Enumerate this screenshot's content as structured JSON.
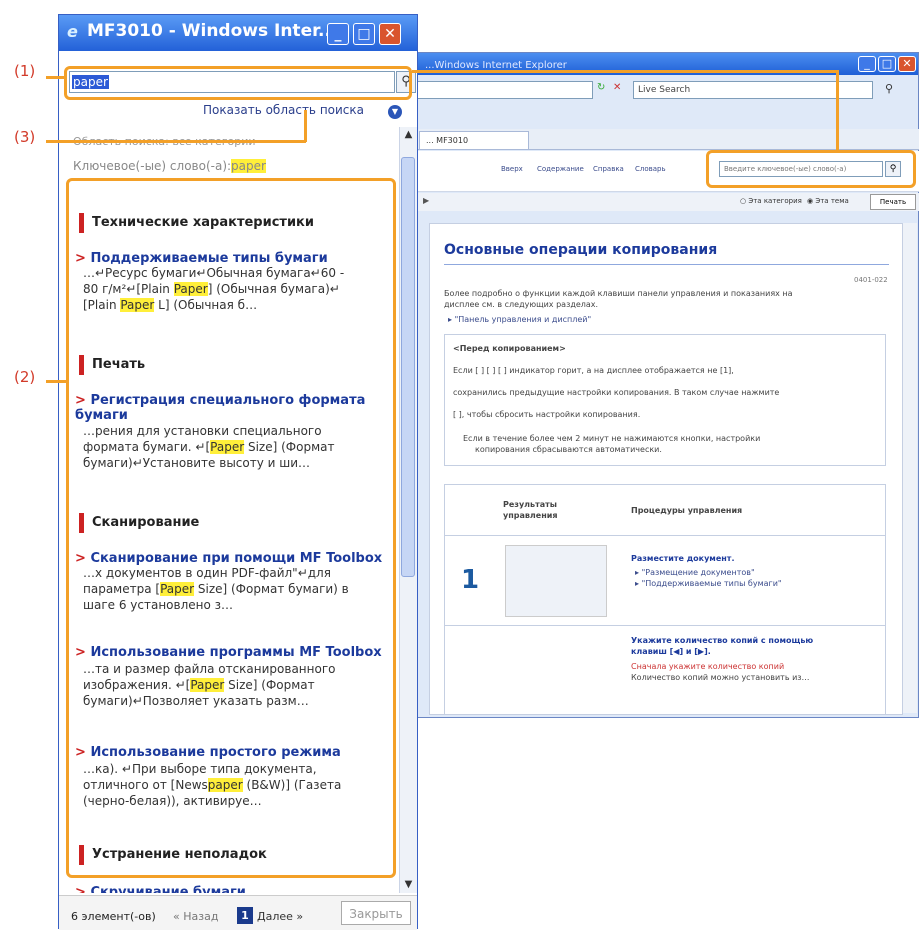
{
  "popup": {
    "title": "MF3010 - Windows Inter...",
    "search_value": "paper",
    "show_search_area": "Показать область поиска",
    "search_area_label": "Область поиска: все категории",
    "keyword_prefix": "Ключевое(-ые) слово(-а):",
    "keyword": "paper",
    "results": [
      {
        "category": "Технические характеристики"
      },
      {
        "title": "Поддерживаемые типы бумаги",
        "s1": "…↵Ресурс бумаги↵Обычная бумага↵60 -",
        "s2a": "80 г/м²↵[Plain ",
        "s2hl": "Paper",
        "s2b": "] (Обычная бумага)↵",
        "s3a": "[Plain ",
        "s3hl": "Paper",
        "s3b": " L] (Обычная б…"
      },
      {
        "category": "Печать"
      },
      {
        "title1": "Регистрация специального формата",
        "title2": "бумаги",
        "s1": "…рения для установки специального",
        "s2a": "формата бумаги. ↵[",
        "s2hl": "Paper",
        "s2b": " Size] (Формат",
        "s3": "бумаги)↵Установите высоту и ши…"
      },
      {
        "category": "Сканирование"
      },
      {
        "title": "Сканирование при помощи MF Toolbox",
        "s1": "…х документов в один PDF-файл\"↵для",
        "s2a": "параметра [",
        "s2hl": "Paper",
        "s2b": " Size] (Формат бумаги) в",
        "s3": "шаге 6 установлено з…"
      },
      {
        "title": "Использование программы MF Toolbox",
        "s1": "…та и размер файла отсканированного",
        "s2a": "изображения. ↵[",
        "s2hl": "Paper",
        "s2b": " Size] (Формат",
        "s3": "бумаги)↵Позволяет указать разм…"
      },
      {
        "title": "Использование простого режима",
        "s1": "…ка). ↵При выборе типа документа,",
        "s2a": "отличного от [News",
        "s2hl": "paper",
        "s2b": " (B&W)] (Газета",
        "s3": "(черно-белая)), активируе…"
      },
      {
        "category": "Устранение неполадок"
      },
      {
        "title": "Скручивание бумаги"
      }
    ],
    "footer": {
      "count": "6 элемент(-ов)",
      "prev": "« Назад",
      "page": "1",
      "next": "Далее »",
      "close": "Закрыть"
    }
  },
  "background": {
    "title": "...Windows Internet Explorer",
    "live_search": "Live Search",
    "tab": "... MF3010",
    "nav_links": [
      "Вверх",
      "Содержание",
      "Справка",
      "Словарь"
    ],
    "search_placeholder": "Введите ключевое(-ые) слово(-а)",
    "radio1": "Эта категория",
    "radio2": "Эта тема",
    "print_btn": "Печать",
    "page_title": "Основные операции копирования",
    "code": "0401-022",
    "intro1": "Более подробно о функции каждой клавиши панели управления и показаниях на",
    "intro2": "дисплее см. в следующих разделах.",
    "intro_link": "\"Панель управления и дисплей\"",
    "before_title": "<Перед копированием>",
    "before1": "Если [  ] [  ] [  ] индикатор горит, а на дисплее отображается не [1],",
    "before2": "сохранились предыдущие настройки копирования. В таком случае нажмите",
    "before3": "[    ], чтобы сбросить настройки копирования.",
    "note1": "Если в течение более чем 2 минут не нажимаются кнопки, настройки",
    "note2": "копирования сбрасываются автоматически.",
    "col1": "Результаты управления",
    "col2": "Процедуры управления",
    "step1_num": "1",
    "step1_title": "Разместите документ.",
    "step1_link1": "\"Размещение документов\"",
    "step1_link2": "\"Поддерживаемые типы бумаги\"",
    "step2_title": "Укажите количество копий с помощью",
    "step2_title2": "клавиш [◀] и [▶].",
    "step2_red": "Сначала укажите количество копий",
    "step2_text": "Количество копий можно установить из…"
  },
  "callouts": {
    "c1": "(1)",
    "c2": "(2)",
    "c3": "(3)"
  },
  "colors": {
    "accent": "#f3a028",
    "callout": "#d23b2a",
    "title_blue": "#1c3a9c",
    "highlight": "#ffef3a"
  }
}
